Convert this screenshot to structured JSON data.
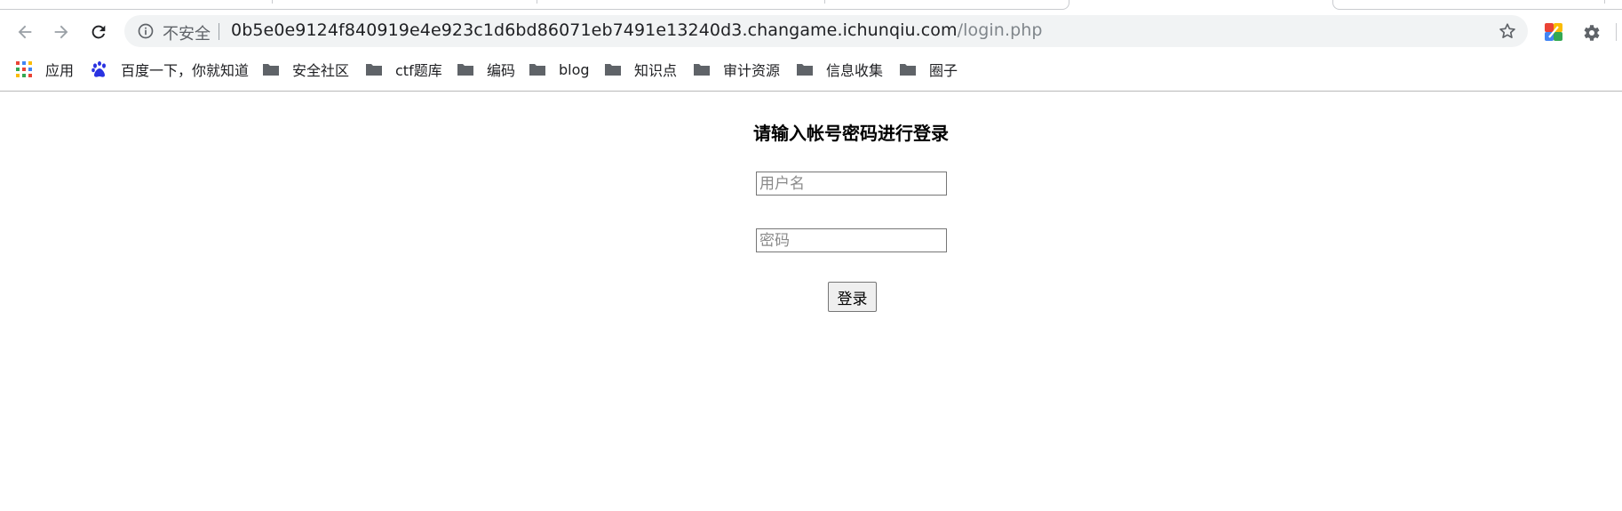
{
  "toolbar": {
    "back_icon": "arrow-left-icon",
    "forward_icon": "arrow-right-icon",
    "reload_icon": "reload-icon"
  },
  "address_bar": {
    "security_label": "不安全",
    "host": "0b5e0e9124f840919e4e923c1d6bd86071eb7491e13240d3.changame.ichunqiu.com",
    "path": "/login.php"
  },
  "bookmarks": [
    {
      "label": "应用",
      "icon": "apps-grid-icon"
    },
    {
      "label": "百度一下，你就知道",
      "icon": "baidu-paw-icon"
    },
    {
      "label": "安全社区",
      "icon": "folder-icon"
    },
    {
      "label": "ctf题库",
      "icon": "folder-icon"
    },
    {
      "label": "编码",
      "icon": "folder-icon"
    },
    {
      "label": "blog",
      "icon": "folder-icon"
    },
    {
      "label": "知识点",
      "icon": "folder-icon"
    },
    {
      "label": "审计资源",
      "icon": "folder-icon"
    },
    {
      "label": "信息收集",
      "icon": "folder-icon"
    },
    {
      "label": "圈子",
      "icon": "folder-icon"
    }
  ],
  "login": {
    "title": "请输入帐号密码进行登录",
    "username_placeholder": "用户名",
    "username_value": "",
    "password_placeholder": "密码",
    "password_value": "",
    "submit_label": "登录"
  },
  "colors": {
    "omnibox_bg": "#f1f3f4",
    "url_host": "#202124",
    "url_path": "#80868b",
    "baidu_blue": "#2932e1"
  }
}
